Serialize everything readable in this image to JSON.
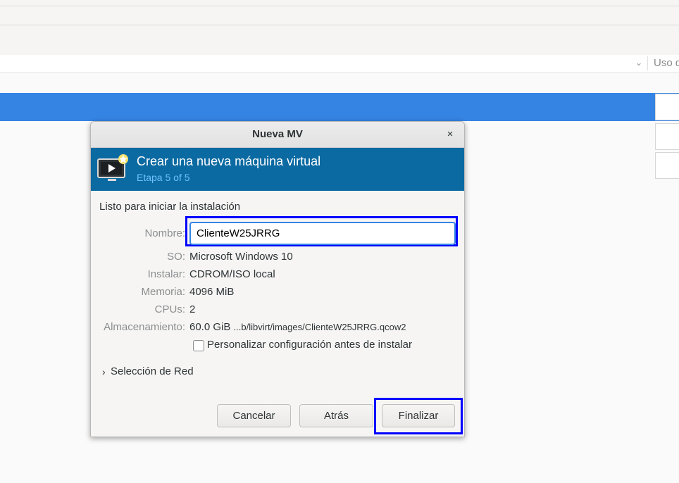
{
  "background": {
    "column_header_label": "Uso d"
  },
  "dialog": {
    "title": "Nueva MV",
    "close_glyph": "×",
    "banner": {
      "title": "Crear una nueva máquina virtual",
      "subtitle": "Etapa 5 of 5"
    },
    "intro": "Listo para iniciar la instalación",
    "fields": {
      "name": {
        "label": "Nombre:",
        "value": "ClienteW25JRRG"
      },
      "os": {
        "label": "SO:",
        "value": "Microsoft Windows 10"
      },
      "install": {
        "label": "Instalar:",
        "value": "CDROM/ISO local"
      },
      "memory": {
        "label": "Memoria:",
        "value": "4096 MiB"
      },
      "cpus": {
        "label": "CPUs:",
        "value": "2"
      },
      "storage": {
        "label": "Almacenamiento:",
        "size": "60.0 GiB",
        "path": "...b/libvirt/images/ClienteW25JRRG.qcow2"
      }
    },
    "customize_checkbox": {
      "label": "Personalizar configuración antes de instalar",
      "checked": false
    },
    "network_expander": {
      "label": "Selección de Red",
      "expanded": false
    },
    "buttons": {
      "cancel": "Cancelar",
      "back": "Atrás",
      "finish": "Finalizar"
    }
  },
  "colors": {
    "selection_blue": "#3584e4",
    "banner_blue": "#0b6aa2",
    "banner_subtitle": "#6ec0ff",
    "highlight_box": "#0000ff"
  }
}
